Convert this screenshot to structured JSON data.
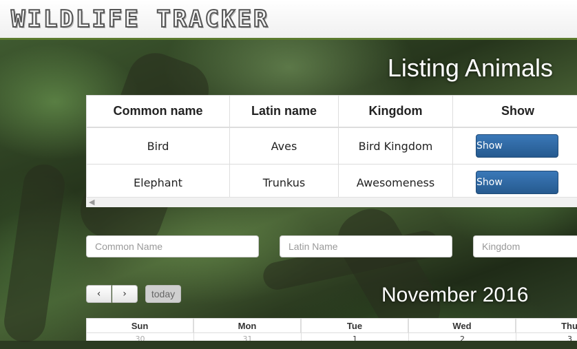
{
  "app": {
    "brand": "WILDLIFE TRACKER"
  },
  "page_title": "Listing Animals",
  "table": {
    "headers": [
      "Common name",
      "Latin name",
      "Kingdom",
      "Show"
    ],
    "rows": [
      {
        "common": "Bird",
        "latin": "Aves",
        "kingdom": "Bird Kingdom",
        "action": "Show"
      },
      {
        "common": "Elephant",
        "latin": "Trunkus",
        "kingdom": "Awesomeness",
        "action": "Show"
      }
    ]
  },
  "form": {
    "common_placeholder": "Common Name",
    "latin_placeholder": "Latin Name",
    "kingdom_placeholder": "Kingdom"
  },
  "calendar": {
    "prev": "‹",
    "next": "›",
    "today": "today",
    "title": "November 2016",
    "day_headers": [
      "Sun",
      "Mon",
      "Tue",
      "Wed",
      "Thu"
    ],
    "first_week": [
      "30",
      "31",
      "1",
      "2",
      "3"
    ]
  },
  "colors": {
    "header_border": "#5b7a2e",
    "show_button": "#2f6aa6"
  }
}
